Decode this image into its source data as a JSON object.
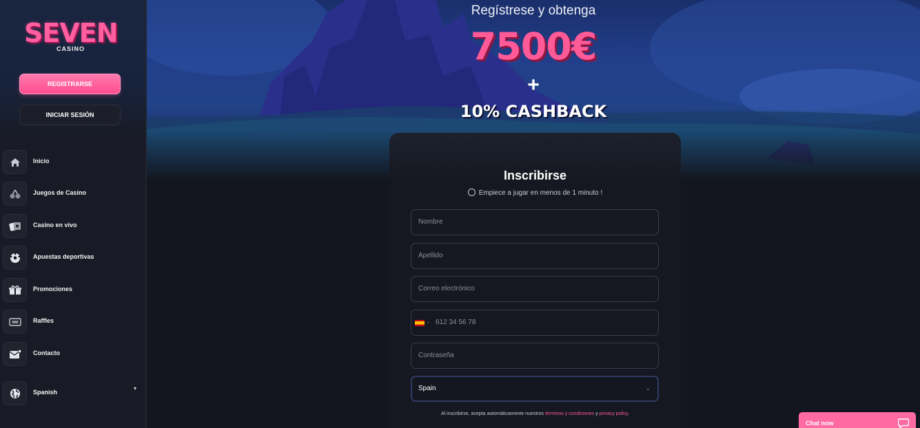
{
  "sidebar": {
    "logo": {
      "main": "SEVEN",
      "sub": "CASINO"
    },
    "register_label": "REGISTRARSE",
    "login_label": "INICIAR SESIÓN",
    "items": [
      {
        "label": "Inicio",
        "icon": "home-icon"
      },
      {
        "label": "Juegos de Casino",
        "icon": "cherries-icon"
      },
      {
        "label": "Casino en vivo",
        "icon": "cards-icon"
      },
      {
        "label": "Apuestas deportivas",
        "icon": "soccer-ball-icon"
      },
      {
        "label": "Promociones",
        "icon": "gift-icon"
      },
      {
        "label": "Raffles",
        "icon": "ticket-icon"
      },
      {
        "label": "Contacto",
        "icon": "mail-icon"
      }
    ],
    "language": {
      "label": "Spanish",
      "icon": "globe-icon"
    }
  },
  "hero": {
    "title": "Regístrese y obtenga",
    "amount": "7500€",
    "plus": "+",
    "cashback": "10% CASHBACK"
  },
  "form": {
    "title": "Inscribirse",
    "subtitle": "Empiece a jugar en menos de 1 minuto !",
    "first_name_placeholder": "Nombre",
    "last_name_placeholder": "Apellido",
    "email_placeholder": "Correo electrónico",
    "phone": {
      "prefix": "-",
      "placeholder": "612 34 56 78",
      "flag": "ES"
    },
    "password_placeholder": "Contraseña",
    "country_value": "Spain",
    "terms": {
      "prefix": "Al inscribirse, acepta automáticamente nuestros ",
      "link1": "términos y condiciones",
      "middle": " y ",
      "link2": "privacy policy",
      "suffix": "."
    }
  },
  "chat": {
    "label": "Chat now"
  },
  "colors": {
    "brand_pink": "#ff5a98",
    "background": "#13161f",
    "sidebar": "#181b25"
  }
}
